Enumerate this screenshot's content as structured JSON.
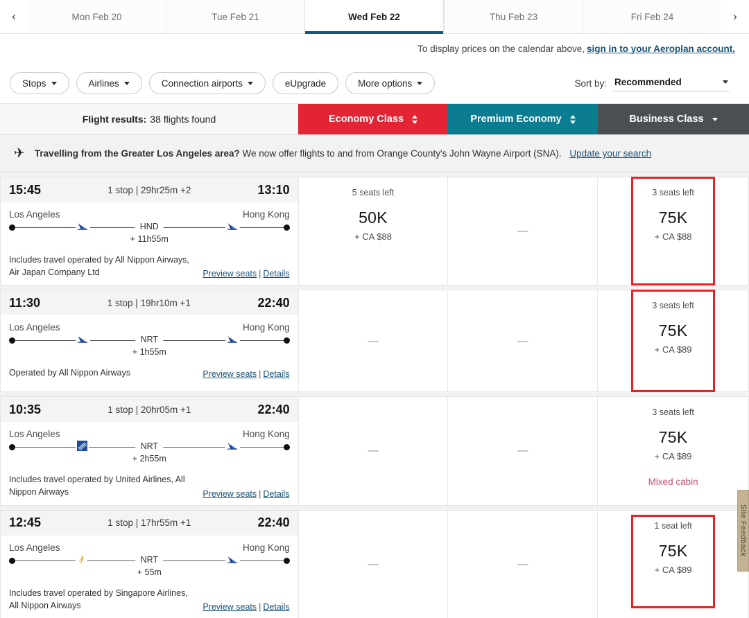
{
  "datebar": {
    "prev_icon": "chevron-left-icon",
    "next_icon": "chevron-right-icon",
    "tabs": [
      {
        "label": "Mon Feb 20",
        "active": false
      },
      {
        "label": "Tue Feb 21",
        "active": false
      },
      {
        "label": "Wed Feb 22",
        "active": true
      },
      {
        "label": "Thu Feb 23",
        "active": false
      },
      {
        "label": "Fri Feb 24",
        "active": false
      }
    ]
  },
  "signin_note": {
    "text": "To display prices on the calendar above,",
    "link": "sign in to your Aeroplan account."
  },
  "filters": {
    "chips": [
      {
        "label": "Stops",
        "caret": true
      },
      {
        "label": "Airlines",
        "caret": true
      },
      {
        "label": "Connection airports",
        "caret": true
      },
      {
        "label": "eUpgrade",
        "caret": false
      },
      {
        "label": "More options",
        "caret": true
      }
    ],
    "sort_label": "Sort by:",
    "sort_value": "Recommended"
  },
  "cabin_header": {
    "results_label": "Flight results:",
    "results_count": "38 flights found",
    "columns": [
      {
        "label": "Economy Class",
        "color": "#e32434",
        "control": "updown"
      },
      {
        "label": "Premium Economy",
        "color": "#0c7c91",
        "control": "updown"
      },
      {
        "label": "Business Class",
        "color": "#4c4f52",
        "control": "caret"
      }
    ]
  },
  "promo": {
    "icon": "airplane-icon",
    "bold": "Travelling from the Greater Los Angeles area?",
    "text": "We now offer flights to and from Orange County's John Wayne Airport (SNA).",
    "link": "Update your search"
  },
  "flights": [
    {
      "depart_time": "15:45",
      "summary": "1 stop | 29hr25m +2",
      "arrive_time": "13:10",
      "origin": "Los Angeles",
      "destination": "Hong Kong",
      "stop_code": "HND",
      "layover": "+ 11h55m",
      "marker_a": "ana-wing-icon",
      "marker_b": "ana-wing-icon",
      "operated_by": "Includes travel operated by All Nippon Airways, Air Japan Company Ltd",
      "preview_seats": "Preview seats",
      "details": "Details",
      "economy": {
        "seats": "5 seats left",
        "points": "50K",
        "cash": "+ CA $88",
        "available": true,
        "highlight": false,
        "mixed": ""
      },
      "premium": {
        "available": false,
        "dash": "—"
      },
      "business": {
        "seats": "3 seats left",
        "points": "75K",
        "cash": "+ CA $88",
        "available": true,
        "highlight": true,
        "highlight_closed": false,
        "mixed": ""
      }
    },
    {
      "depart_time": "11:30",
      "summary": "1 stop | 19hr10m +1",
      "arrive_time": "22:40",
      "origin": "Los Angeles",
      "destination": "Hong Kong",
      "stop_code": "NRT",
      "layover": "+ 1h55m",
      "marker_a": "ana-wing-icon",
      "marker_b": "ana-wing-icon",
      "operated_by": "Operated by All Nippon Airways",
      "preview_seats": "Preview seats",
      "details": "Details",
      "economy": {
        "available": false,
        "dash": "—"
      },
      "premium": {
        "available": false,
        "dash": "—"
      },
      "business": {
        "seats": "3 seats left",
        "points": "75K",
        "cash": "+ CA $89",
        "available": true,
        "highlight": true,
        "highlight_closed": false,
        "mixed": ""
      }
    },
    {
      "depart_time": "10:35",
      "summary": "1 stop | 20hr05m +1",
      "arrive_time": "22:40",
      "origin": "Los Angeles",
      "destination": "Hong Kong",
      "stop_code": "NRT",
      "layover": "+ 2h55m",
      "marker_a": "united-logo-icon",
      "marker_b": "ana-wing-icon",
      "operated_by": "Includes travel operated by United Airlines, All Nippon Airways",
      "preview_seats": "Preview seats",
      "details": "Details",
      "economy": {
        "available": false,
        "dash": "—"
      },
      "premium": {
        "available": false,
        "dash": "—"
      },
      "business": {
        "seats": "3 seats left",
        "points": "75K",
        "cash": "+ CA $89",
        "available": true,
        "highlight": false,
        "highlight_closed": false,
        "mixed": "Mixed cabin"
      }
    },
    {
      "depart_time": "12:45",
      "summary": "1 stop | 17hr55m +1",
      "arrive_time": "22:40",
      "origin": "Los Angeles",
      "destination": "Hong Kong",
      "stop_code": "NRT",
      "layover": "+ 55m",
      "marker_a": "singapore-bird-icon",
      "marker_b": "ana-wing-icon",
      "operated_by": "Includes travel operated by Singapore Airlines, All Nippon Airways",
      "preview_seats": "Preview seats",
      "details": "Details",
      "economy": {
        "available": false,
        "dash": "—"
      },
      "premium": {
        "available": false,
        "dash": "—"
      },
      "business": {
        "seats": "1 seat left",
        "points": "75K",
        "cash": "+ CA $89",
        "available": true,
        "highlight": true,
        "highlight_closed": true,
        "mixed": ""
      }
    }
  ],
  "feedback": {
    "label": "Site Feedback"
  }
}
